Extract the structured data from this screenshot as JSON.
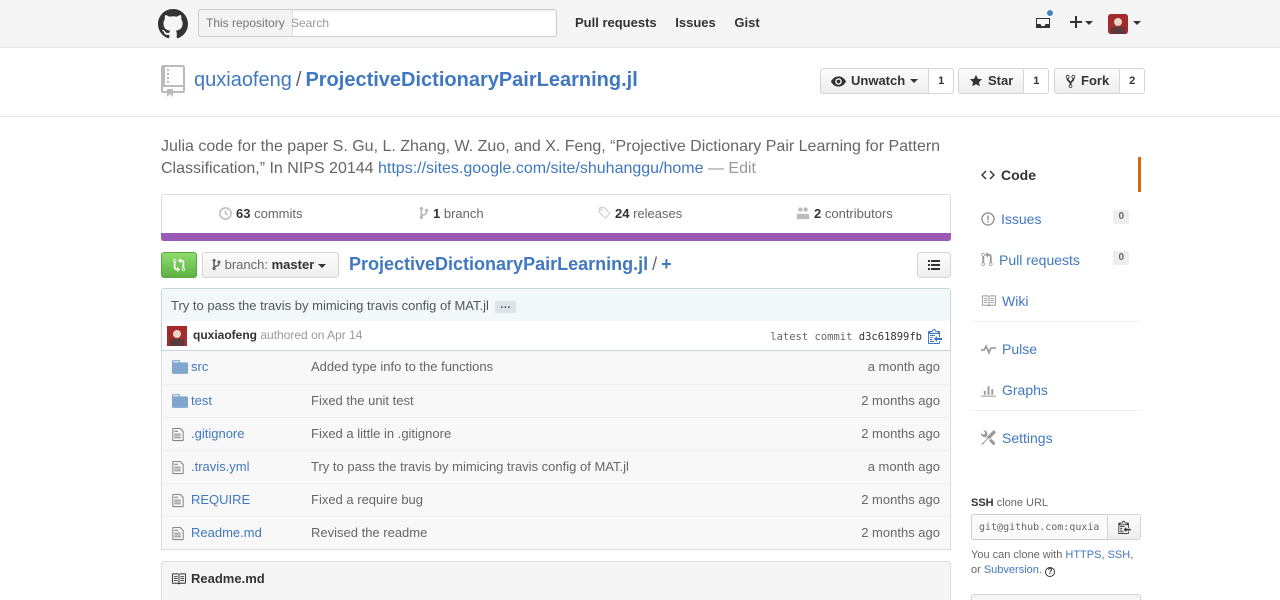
{
  "header": {
    "search_scope": "This repository",
    "search_placeholder": "Search",
    "nav": [
      "Pull requests",
      "Issues",
      "Gist"
    ]
  },
  "repo": {
    "owner": "quxiaofeng",
    "separator": "/",
    "name": "ProjectiveDictionaryPairLearning.jl",
    "watch_label": "Unwatch",
    "watch_count": "1",
    "star_label": "Star",
    "star_count": "1",
    "fork_label": "Fork",
    "fork_count": "2"
  },
  "description": {
    "text": "Julia code for the paper S. Gu, L. Zhang, W. Zuo, and X. Feng, “Projective Dictionary Pair Learning for Pattern Classification,” In NIPS 20144",
    "url": "https://sites.google.com/site/shuhanggu/home",
    "edit": "— Edit"
  },
  "summary": {
    "commits_count": "63",
    "commits_label": "commits",
    "branches_count": "1",
    "branches_label": "branch",
    "releases_count": "24",
    "releases_label": "releases",
    "contributors_count": "2",
    "contributors_label": "contributors",
    "language_color": "#9b59b6"
  },
  "file_nav": {
    "branch_prefix": "branch:",
    "branch_name": "master",
    "breadcrumb_repo": "ProjectiveDictionaryPairLearning.jl",
    "breadcrumb_sep": "/",
    "breadcrumb_add": "+"
  },
  "commit": {
    "message": "Try to pass the travis by mimicing travis config of MAT.jl",
    "ellipsis": "…",
    "author": "quxiaofeng",
    "authored": "authored on Apr 14",
    "latest_label": "latest commit",
    "sha": "d3c61899fb"
  },
  "files": [
    {
      "type": "dir",
      "name": "src",
      "message": "Added type info to the functions",
      "age": "a month ago"
    },
    {
      "type": "dir",
      "name": "test",
      "message": "Fixed the unit test",
      "age": "2 months ago"
    },
    {
      "type": "file",
      "name": ".gitignore",
      "message": "Fixed a little in .gitignore",
      "age": "2 months ago"
    },
    {
      "type": "file",
      "name": ".travis.yml",
      "message": "Try to pass the travis by mimicing travis config of MAT.jl",
      "age": "a month ago"
    },
    {
      "type": "file",
      "name": "REQUIRE",
      "message": "Fixed a require bug",
      "age": "2 months ago"
    },
    {
      "type": "file",
      "name": "Readme.md",
      "message": "Revised the readme",
      "age": "2 months ago"
    }
  ],
  "readme": {
    "title": "Readme.md"
  },
  "sidebar": {
    "items": [
      {
        "label": "Code",
        "icon": "code-icon"
      },
      {
        "label": "Issues",
        "count": "0",
        "icon": "issue-icon"
      },
      {
        "label": "Pull requests",
        "count": "0",
        "icon": "pull-request-icon"
      },
      {
        "label": "Wiki",
        "icon": "book-icon"
      },
      {
        "label": "Pulse",
        "icon": "pulse-icon"
      },
      {
        "label": "Graphs",
        "icon": "graph-icon"
      },
      {
        "label": "Settings",
        "icon": "tools-icon"
      }
    ],
    "clone_protocol": "SSH",
    "clone_label": "clone URL",
    "clone_url": "git@github.com:quxiaofeng/ProjectiveDictionaryPairLearning.jl.git",
    "clone_help_prefix": "You can clone with",
    "clone_https": "HTTPS",
    "clone_ssh": "SSH",
    "clone_or": "or",
    "clone_svn": "Subversion",
    "clone_help_suffix": "."
  }
}
